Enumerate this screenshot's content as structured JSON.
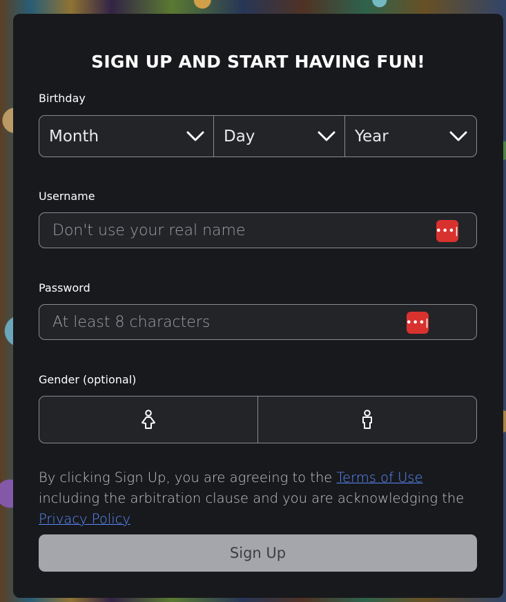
{
  "form": {
    "title": "SIGN UP AND START HAVING FUN!",
    "birthday": {
      "label": "Birthday",
      "month": "Month",
      "day": "Day",
      "year": "Year"
    },
    "username": {
      "label": "Username",
      "placeholder": "Don't use your real name",
      "value": ""
    },
    "password": {
      "label": "Password",
      "placeholder": "At least 8 characters",
      "value": ""
    },
    "gender": {
      "label": "Gender (optional)",
      "options": [
        "female-icon",
        "male-icon"
      ]
    },
    "legal": {
      "text_1": "By clicking Sign Up, you are agreeing to the ",
      "terms_link": "Terms of Use",
      "text_2": " including the arbitration clause and you are acknowledging the ",
      "privacy_link": "Privacy Policy"
    },
    "signup_button": "Sign Up"
  },
  "icons": {
    "dropdown": "chevron-down-icon",
    "password_manager": "password-manager-icon",
    "password_manager_glyph": "•••|"
  },
  "colors": {
    "panel_bg": "#18191d",
    "field_bg": "#232428",
    "field_border": "#8a8c92",
    "link": "#5b8cff",
    "password_manager": "#d8322f",
    "signup_button": "#a4a6ab"
  }
}
